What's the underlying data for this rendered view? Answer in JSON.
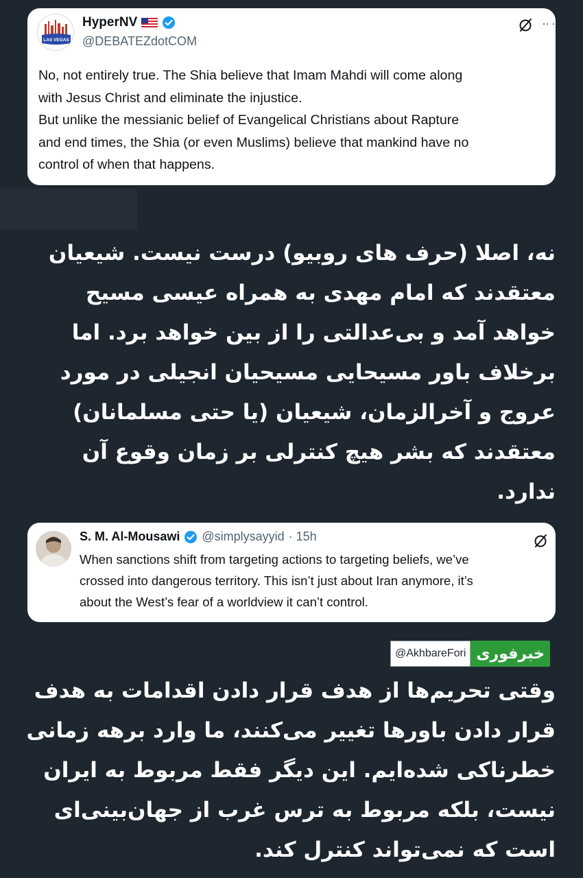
{
  "tweet1": {
    "author_name": "HyperNV",
    "handle": "@DEBATEZdotCOM",
    "avatar_label": "LAS VEGAS",
    "body_lines": [
      "No, not entirely true. The Shia believe that Imam Mahdi will come along",
      "with Jesus Christ and eliminate the injustice.",
      "But unlike the messianic belief of Evangelical Christians  about Rapture",
      "and end times, the Shia (or even Muslims) believe that mankind have no",
      "control of when that happens."
    ],
    "more_label": "·· ·"
  },
  "translation1": {
    "lines": [
      "نه، اصلا (حرف های روبیو) درست نیست. شیعیان",
      "معتقدند که امام مهدی به همراه عیسی مسیح",
      "خواهد آمد و بی‌عدالتی را از بین خواهد برد. اما",
      "برخلاف باور مسیحایی مسیحیان انجیلی در مورد",
      "عروج و آخرالزمان، شیعیان (یا حتی مسلمانان)",
      "معتقدند که بشر هیچ کنترلی بر زمان وقوع آن",
      "ندارد."
    ]
  },
  "tweet2": {
    "author_name": "S. M. Al-Mousawi",
    "handle": "@simplysayyid",
    "time": "· 15h",
    "body_lines": [
      "When sanctions shift from targeting actions to targeting beliefs, we’ve",
      "crossed into dangerous territory. This isn’t just about Iran anymore, it’s",
      "about the West’s fear of a worldview it can’t control."
    ]
  },
  "watermark": {
    "handle": "@AkhbareFori",
    "logo_text": "خبرفوری"
  },
  "translation2": {
    "lines": [
      "وقتی تحریم‌ها از هدف قرار دادن اقدامات به هدف",
      "قرار دادن باورها تغییر می‌کنند، ما وارد برهه زمانی",
      "خطرناکی شده‌ایم. این دیگر فقط مربوط به ایران",
      "نیست، بلکه مربوط به ترس غرب از جهان‌بینی‌ای",
      "است که نمی‌تواند کنترل کند."
    ]
  },
  "colors": {
    "background": "#1e2730",
    "verified_blue": "#1d9bf0",
    "logo_green": "#2e9b3b"
  }
}
